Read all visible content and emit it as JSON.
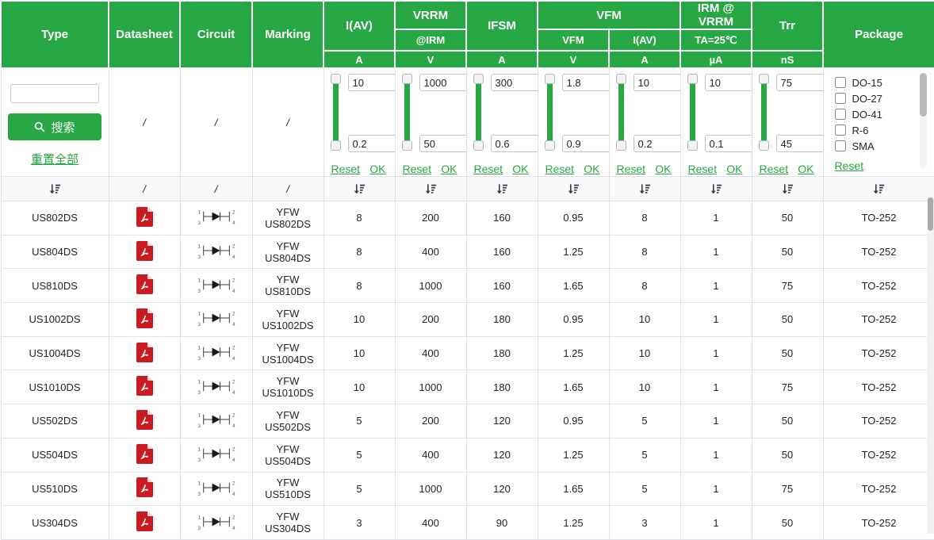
{
  "table": {
    "header": {
      "type": "Type",
      "datasheet": "Datasheet",
      "circuit": "Circuit",
      "marking": "Marking",
      "iav": {
        "label": "I(AV)",
        "unit": "A"
      },
      "vrrm": {
        "label": "VRRM",
        "sub": "@IRM",
        "unit": "V"
      },
      "ifsm": {
        "label": "IFSM",
        "unit": "A"
      },
      "vfm_group": {
        "label": "VFM",
        "col1": {
          "label": "VFM",
          "unit": "V"
        },
        "col2": {
          "label": "I(AV)",
          "unit": "A"
        }
      },
      "irm": {
        "label": "IRM @ VRRM",
        "sub": "TA=25℃",
        "unit": "µA"
      },
      "trr": {
        "label": "Trr",
        "unit": "nS"
      },
      "package": "Package"
    },
    "filter_row": {
      "search_value": "",
      "search_button": "搜索",
      "reset_all": "重置全部",
      "na": "/",
      "sliders": [
        {
          "name": "iav",
          "max": "10",
          "min": "0.2",
          "reset": "Reset",
          "ok": "OK"
        },
        {
          "name": "vrrm",
          "max": "1000",
          "min": "50",
          "reset": "Reset",
          "ok": "OK"
        },
        {
          "name": "ifsm",
          "max": "300",
          "min": "0.6",
          "reset": "Reset",
          "ok": "OK"
        },
        {
          "name": "vfm",
          "max": "1.8",
          "min": "0.9",
          "reset": "Reset",
          "ok": "OK"
        },
        {
          "name": "vfm_iav",
          "max": "10",
          "min": "0.2",
          "reset": "Reset",
          "ok": "OK"
        },
        {
          "name": "irm",
          "max": "10",
          "min": "0.1",
          "reset": "Reset",
          "ok": "OK"
        },
        {
          "name": "trr",
          "max": "75",
          "min": "45",
          "reset": "Reset",
          "ok": "OK"
        }
      ],
      "package_options": [
        {
          "label": "DO-15"
        },
        {
          "label": "DO-27"
        },
        {
          "label": "DO-41"
        },
        {
          "label": "R-6"
        },
        {
          "label": "SMA"
        }
      ],
      "package_reset": "Reset"
    },
    "sort_row": {
      "na": "/"
    },
    "rows": [
      {
        "type": "US802DS",
        "marking": "YFW US802DS",
        "iav": "8",
        "vrrm": "200",
        "ifsm": "160",
        "vfm": "0.95",
        "vfm_iav": "8",
        "irm": "1",
        "trr": "50",
        "package": "TO-252"
      },
      {
        "type": "US804DS",
        "marking": "YFW US804DS",
        "iav": "8",
        "vrrm": "400",
        "ifsm": "160",
        "vfm": "1.25",
        "vfm_iav": "8",
        "irm": "1",
        "trr": "50",
        "package": "TO-252"
      },
      {
        "type": "US810DS",
        "marking": "YFW US810DS",
        "iav": "8",
        "vrrm": "1000",
        "ifsm": "160",
        "vfm": "1.65",
        "vfm_iav": "8",
        "irm": "1",
        "trr": "75",
        "package": "TO-252"
      },
      {
        "type": "US1002DS",
        "marking": "YFW US1002DS",
        "iav": "10",
        "vrrm": "200",
        "ifsm": "180",
        "vfm": "0.95",
        "vfm_iav": "10",
        "irm": "1",
        "trr": "50",
        "package": "TO-252"
      },
      {
        "type": "US1004DS",
        "marking": "YFW US1004DS",
        "iav": "10",
        "vrrm": "400",
        "ifsm": "180",
        "vfm": "1.25",
        "vfm_iav": "10",
        "irm": "1",
        "trr": "50",
        "package": "TO-252"
      },
      {
        "type": "US1010DS",
        "marking": "YFW US1010DS",
        "iav": "10",
        "vrrm": "1000",
        "ifsm": "180",
        "vfm": "1.65",
        "vfm_iav": "10",
        "irm": "1",
        "trr": "75",
        "package": "TO-252"
      },
      {
        "type": "US502DS",
        "marking": "YFW US502DS",
        "iav": "5",
        "vrrm": "200",
        "ifsm": "120",
        "vfm": "0.95",
        "vfm_iav": "5",
        "irm": "1",
        "trr": "50",
        "package": "TO-252"
      },
      {
        "type": "US504DS",
        "marking": "YFW US504DS",
        "iav": "5",
        "vrrm": "400",
        "ifsm": "120",
        "vfm": "1.25",
        "vfm_iav": "5",
        "irm": "1",
        "trr": "50",
        "package": "TO-252"
      },
      {
        "type": "US510DS",
        "marking": "YFW US510DS",
        "iav": "5",
        "vrrm": "1000",
        "ifsm": "120",
        "vfm": "1.65",
        "vfm_iav": "5",
        "irm": "1",
        "trr": "75",
        "package": "TO-252"
      },
      {
        "type": "US304DS",
        "marking": "YFW US304DS",
        "iav": "3",
        "vrrm": "400",
        "ifsm": "90",
        "vfm": "1.25",
        "vfm_iav": "3",
        "irm": "1",
        "trr": "50",
        "package": "TO-252"
      }
    ]
  },
  "colors": {
    "accent_green": "#28a745",
    "header_text": "#ffffff",
    "pdf_red": "#ca1a22",
    "sort_row_bg": "#f8f9fa"
  }
}
